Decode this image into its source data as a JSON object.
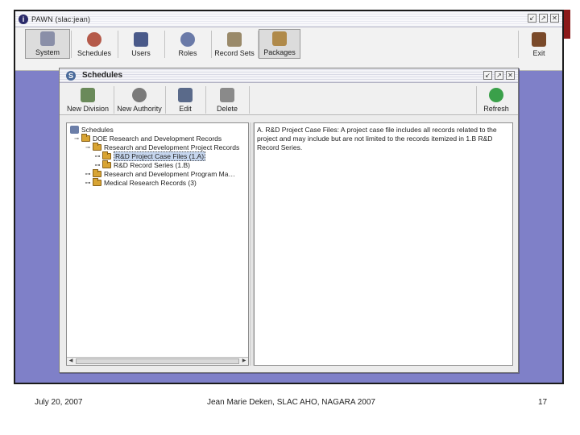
{
  "app": {
    "title": "PAWN (slac:jean)",
    "window_controls": [
      "↙",
      "↗",
      "✕"
    ],
    "toolbar": [
      {
        "label": "System",
        "icon": "system-icon",
        "pressed": true
      },
      {
        "label": "Schedules",
        "icon": "schedules-icon",
        "pressed": false
      },
      {
        "label": "Users",
        "icon": "users-icon",
        "pressed": false
      },
      {
        "label": "Roles",
        "icon": "roles-icon",
        "pressed": false
      },
      {
        "label": "Record Sets",
        "icon": "record-sets-icon",
        "pressed": false
      },
      {
        "label": "Packages",
        "icon": "packages-icon",
        "pressed": false
      }
    ],
    "exit_label": "Exit"
  },
  "schedules_window": {
    "title": "Schedules",
    "window_controls": [
      "↙",
      "↗",
      "✕"
    ],
    "toolbar": [
      {
        "label": "New Division",
        "icon": "new-division-icon"
      },
      {
        "label": "New Authority",
        "icon": "new-authority-icon"
      },
      {
        "label": "Edit",
        "icon": "edit-icon"
      },
      {
        "label": "Delete",
        "icon": "delete-icon"
      }
    ],
    "refresh_label": "Refresh",
    "tree": [
      {
        "label": "Schedules",
        "level": 0,
        "toggle": "",
        "icon": "schedules-root"
      },
      {
        "label": "DOE Research and Development Records",
        "level": 1,
        "toggle": "⊸",
        "icon": "folder"
      },
      {
        "label": "Research and Development Project Records",
        "level": 2,
        "toggle": "⊸",
        "icon": "folder"
      },
      {
        "label": "R&D Project Case Files (1.A)",
        "level": 3,
        "toggle": "⊶",
        "icon": "folder",
        "selected": true
      },
      {
        "label": "R&D Record Series (1.B)",
        "level": 3,
        "toggle": "⊶",
        "icon": "folder"
      },
      {
        "label": "Research and Development Program Ma…",
        "level": 1,
        "toggle": "⊶",
        "icon": "folder"
      },
      {
        "label": "Medical Research Records (3)",
        "level": 1,
        "toggle": "⊶",
        "icon": "folder"
      }
    ],
    "description": "A. R&D Project Case Files: A project case file includes all records related to the project and may include but are not limited to the records itemized in 1.B R&D Record Series."
  },
  "footer": {
    "date": "July 20, 2007",
    "presenter": "Jean Marie Deken, SLAC AHO, NAGARA 2007",
    "page": "17"
  },
  "colors": {
    "desktop": "#7f80c8",
    "selection": "#c6d6ee",
    "folder": "#d8a433",
    "accent_red": "#8b1a1a"
  }
}
